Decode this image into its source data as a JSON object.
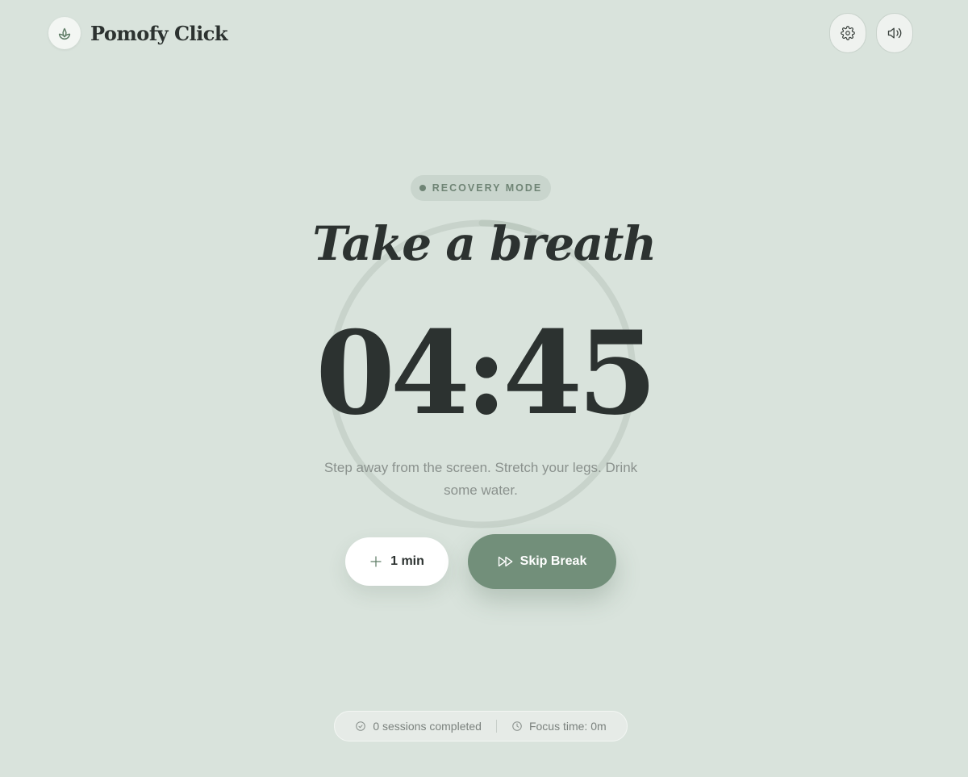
{
  "app": {
    "name": "Pomofy Click"
  },
  "header": {
    "settings_icon": "gear-icon",
    "sound_icon": "speaker-icon"
  },
  "mode": {
    "label": "RECOVERY MODE"
  },
  "timer": {
    "headline": "Take a breath",
    "time": "04:45",
    "message": "Step away from the screen. Stretch your legs. Drink some water.",
    "progress": 0.05
  },
  "actions": {
    "add_label": "1 min",
    "skip_label": "Skip Break"
  },
  "stats": {
    "sessions": "0 sessions completed",
    "focus_time": "Focus time: 0m"
  },
  "colors": {
    "background": "#d9e3dc",
    "accent": "#728f7a",
    "ring_track": "#c8d3cb",
    "text_dark": "#2c3230"
  }
}
